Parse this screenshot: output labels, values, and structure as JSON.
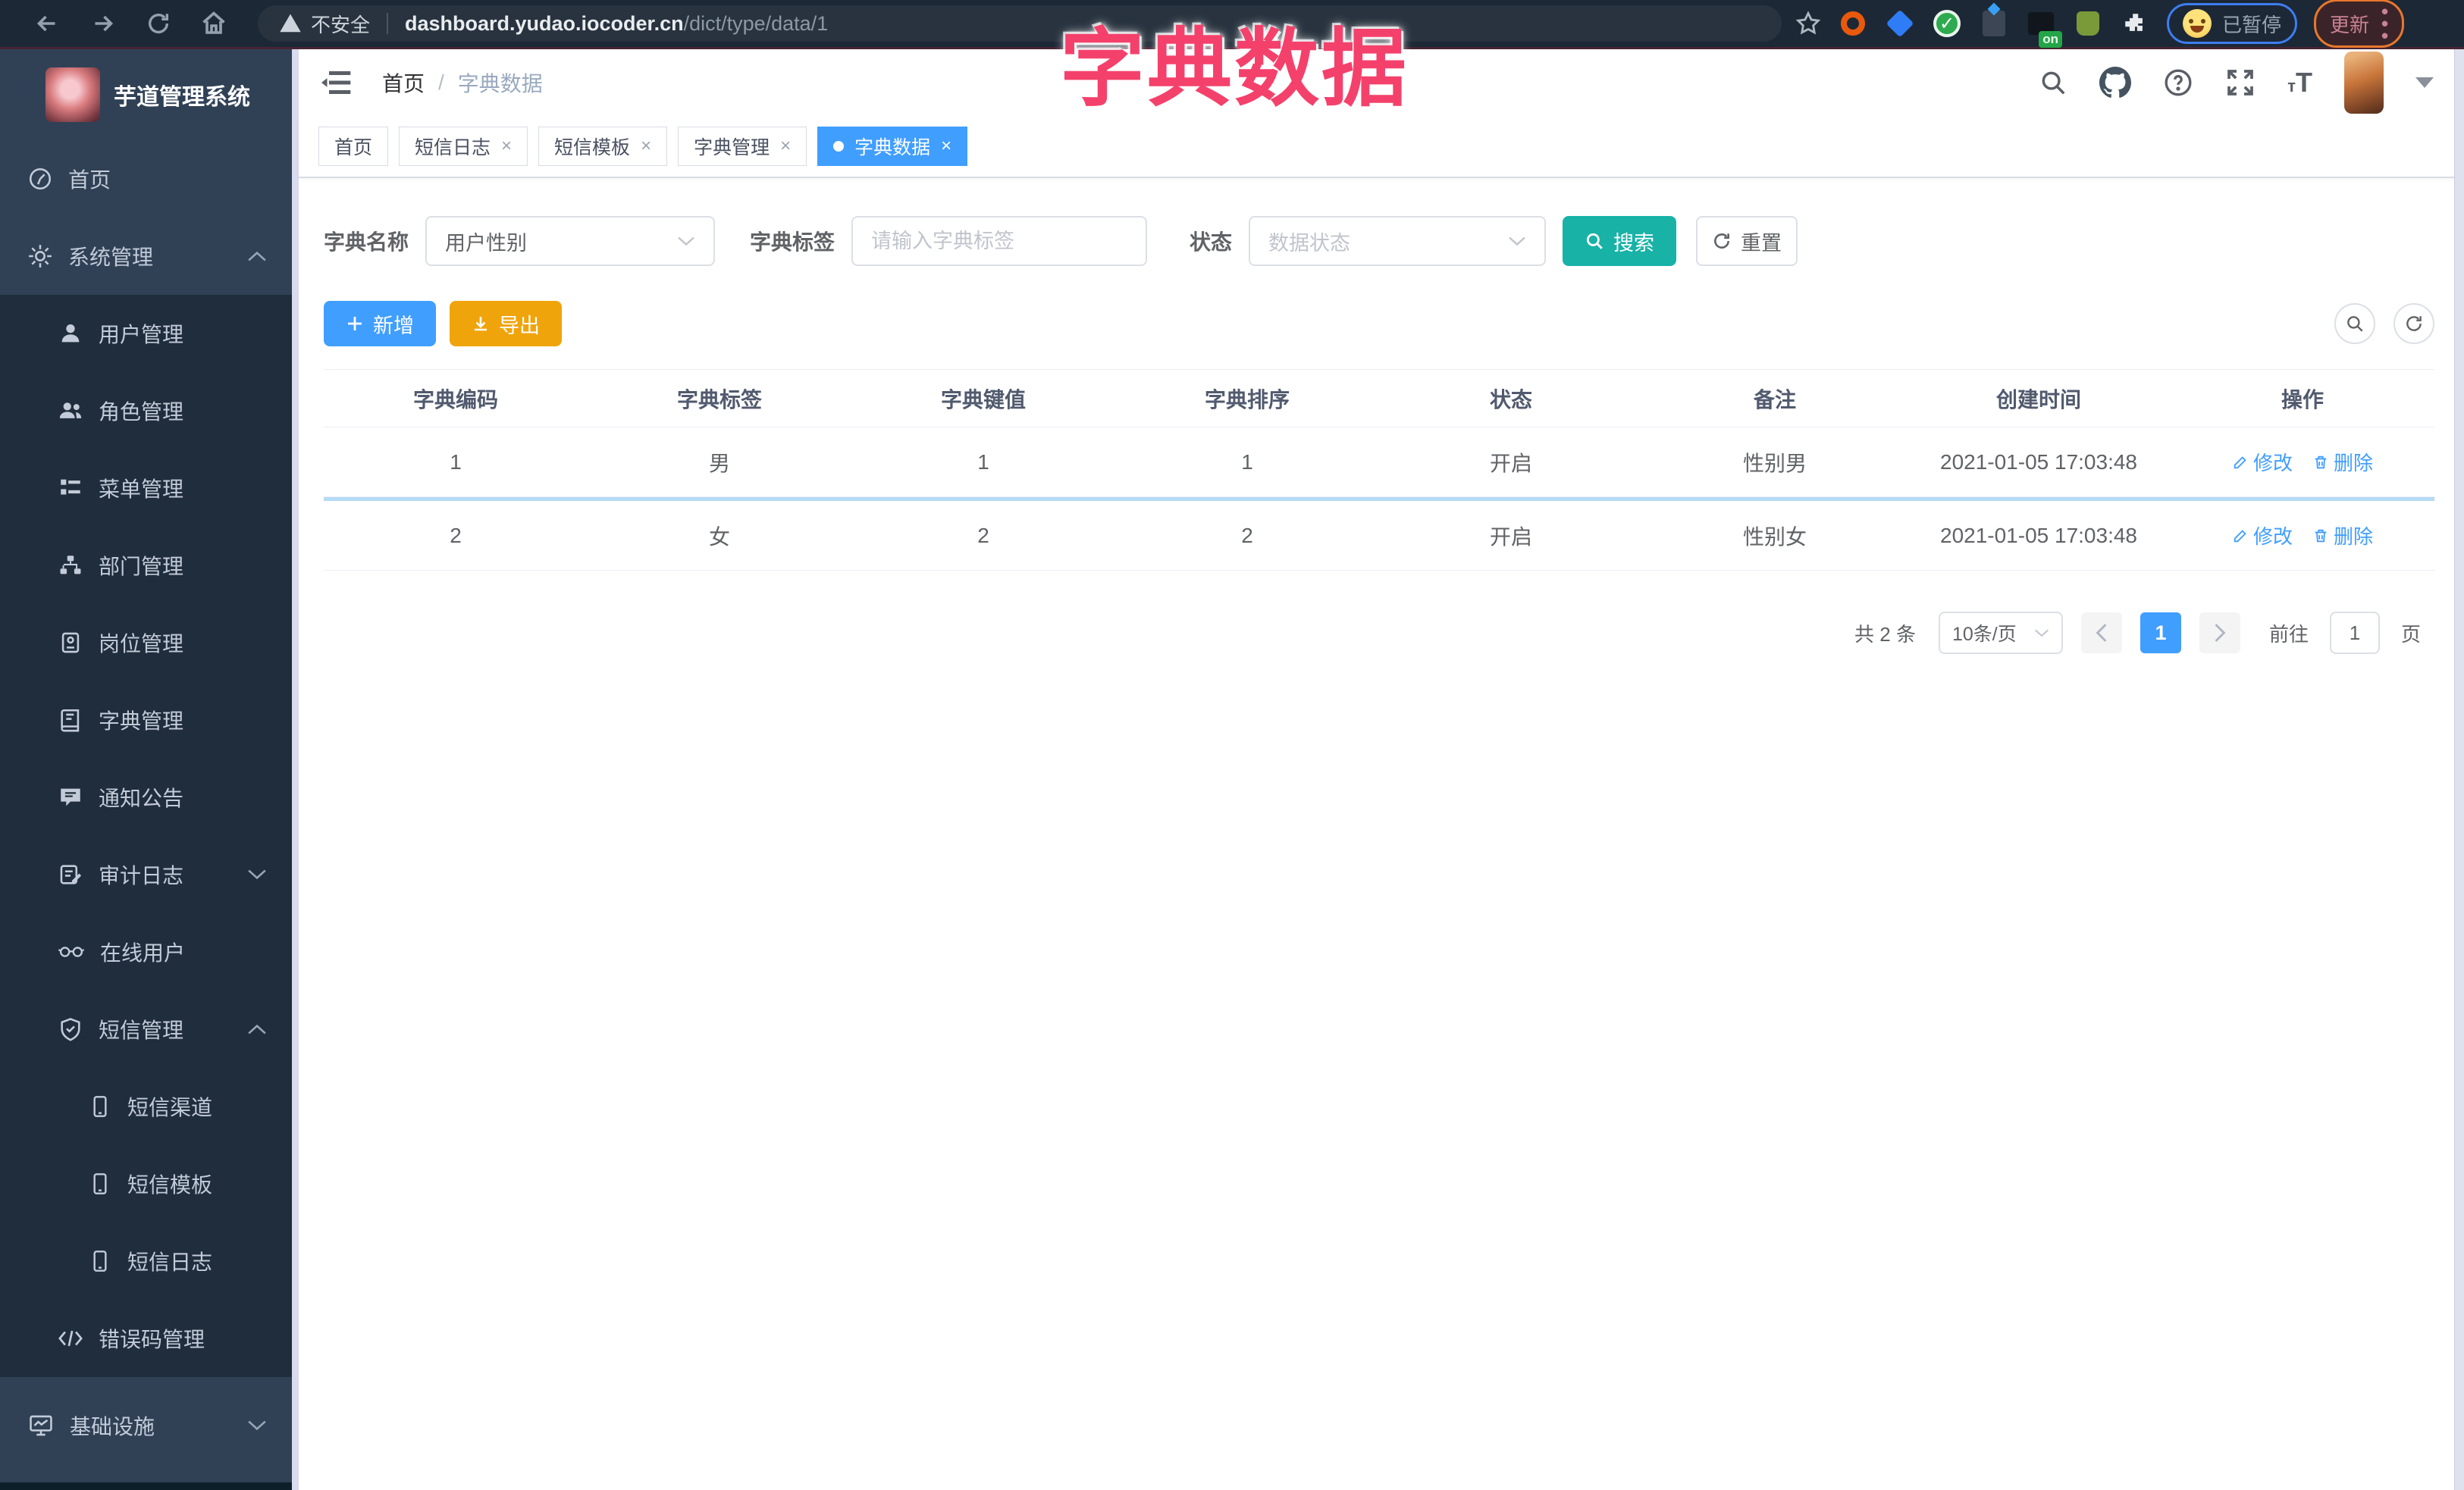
{
  "browser": {
    "security": "不安全",
    "url_host": "dashboard.yudao.iocoder.cn",
    "url_path": "/dict/type/data/1",
    "ext_on_badge": "on",
    "profile_status": "已暂停",
    "update_label": "更新"
  },
  "annotation": {
    "title": "字典数据"
  },
  "colors": {
    "primary": "#409eff",
    "search_button": "#18b2a7",
    "export_button": "#f0a40c",
    "annotation_pink": "#f4416b",
    "sidebar_bg": "#304156",
    "submenu_bg": "#1f2d3d"
  },
  "sidebar": {
    "logo_title": "芋道管理系统",
    "items": [
      {
        "label": "首页"
      },
      {
        "label": "系统管理"
      },
      {
        "label": "用户管理"
      },
      {
        "label": "角色管理"
      },
      {
        "label": "菜单管理"
      },
      {
        "label": "部门管理"
      },
      {
        "label": "岗位管理"
      },
      {
        "label": "字典管理"
      },
      {
        "label": "通知公告"
      },
      {
        "label": "审计日志"
      },
      {
        "label": "在线用户"
      },
      {
        "label": "短信管理"
      },
      {
        "label": "短信渠道"
      },
      {
        "label": "短信模板"
      },
      {
        "label": "短信日志"
      },
      {
        "label": "错误码管理"
      },
      {
        "label": "基础设施"
      }
    ]
  },
  "header": {
    "breadcrumb_home": "首页",
    "breadcrumb_current": "字典数据"
  },
  "tabs": [
    {
      "label": "首页"
    },
    {
      "label": "短信日志"
    },
    {
      "label": "短信模板"
    },
    {
      "label": "字典管理"
    },
    {
      "label": "字典数据"
    }
  ],
  "filters": {
    "dict_name_label": "字典名称",
    "dict_name_value": "用户性别",
    "dict_label_label": "字典标签",
    "dict_label_placeholder": "请输入字典标签",
    "status_label": "状态",
    "status_placeholder": "数据状态",
    "search_label": "搜索",
    "reset_label": "重置"
  },
  "toolbar": {
    "add_label": "新增",
    "export_label": "导出"
  },
  "table": {
    "headers": [
      "字典编码",
      "字典标签",
      "字典键值",
      "字典排序",
      "状态",
      "备注",
      "创建时间",
      "操作"
    ],
    "edit_label": "修改",
    "delete_label": "删除",
    "rows": [
      {
        "code": "1",
        "label": "男",
        "value": "1",
        "sort": "1",
        "status": "开启",
        "remark": "性别男",
        "created": "2021-01-05 17:03:48"
      },
      {
        "code": "2",
        "label": "女",
        "value": "2",
        "sort": "2",
        "status": "开启",
        "remark": "性别女",
        "created": "2021-01-05 17:03:48"
      }
    ]
  },
  "pagination": {
    "total": "共 2 条",
    "page_size": "10条/页",
    "current_page": "1",
    "goto_label": "前往",
    "goto_value": "1",
    "page_unit": "页"
  }
}
